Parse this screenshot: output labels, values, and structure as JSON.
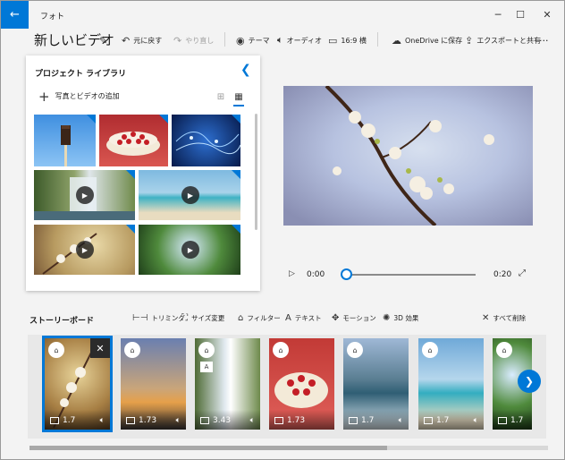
{
  "titlebar": {
    "app_title": "フォト",
    "back_icon": "arrow-left-icon",
    "minimize": "─",
    "maximize": "☐",
    "close": "✕"
  },
  "toolbar": {
    "project_title": "新しいビデオ",
    "undo": "元に戻す",
    "redo": "やり直し",
    "theme": "テーマ",
    "audio": "オーディオ",
    "aspect": "16:9 横",
    "save_onedrive": "OneDrive に保存",
    "export_share": "エクスポートと共有",
    "more": "···"
  },
  "library": {
    "title": "プロジェクト ライブラリ",
    "add_label": "写真とビデオの追加"
  },
  "player": {
    "current_time": "0:00",
    "total_time": "0:20",
    "progress": 0.0
  },
  "storyboard": {
    "title": "ストーリーボード",
    "tools": {
      "trim": "トリミング",
      "resize": "サイズ変更",
      "filter": "フィルター",
      "text": "テキスト",
      "motion": "モーション",
      "effects3d": "3D 効果",
      "remove_all": "すべて削除"
    },
    "cards": [
      {
        "duration": "1.7",
        "selected": true
      },
      {
        "duration": "1.73"
      },
      {
        "duration": "3.43"
      },
      {
        "duration": "1.73"
      },
      {
        "duration": "1.7"
      },
      {
        "duration": "1.7"
      },
      {
        "duration": "1.7"
      }
    ]
  },
  "colors": {
    "accent": "#0078d7"
  }
}
